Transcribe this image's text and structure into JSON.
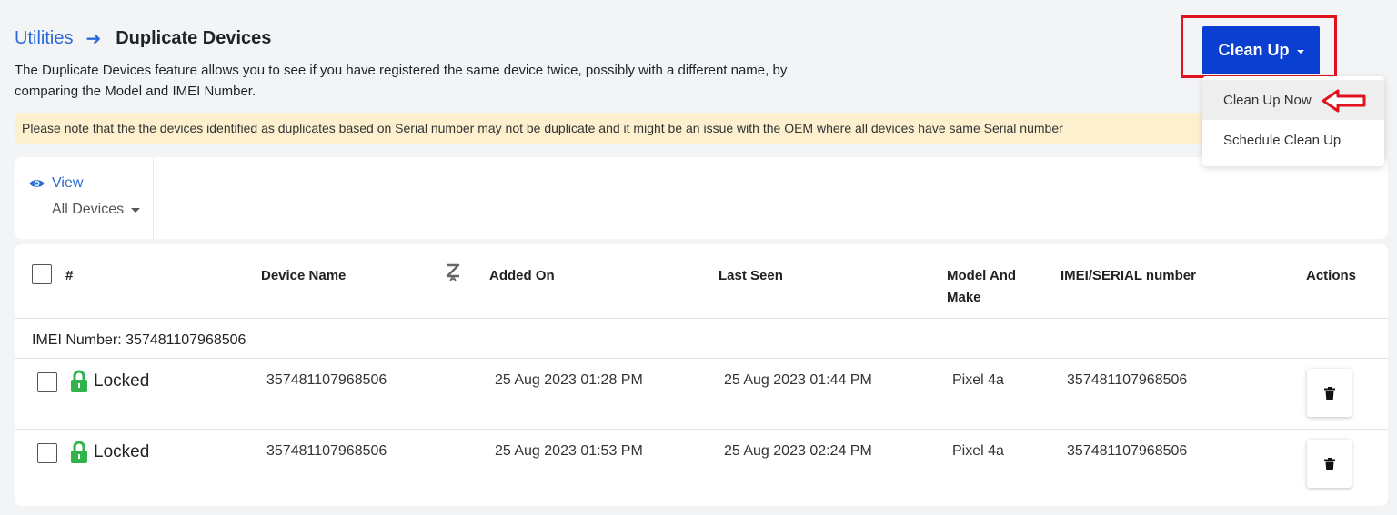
{
  "breadcrumb": {
    "parent": "Utilities",
    "current": "Duplicate Devices"
  },
  "description": "The Duplicate Devices feature allows you to see if you have registered the same device twice, possibly with a different name, by comparing the Model and IMEI Number.",
  "note": "Please note that the the devices identified as duplicates based on Serial number may not be duplicate and it might be an issue with the OEM where all devices have same Serial number",
  "cleanup": {
    "label": "Clean Up",
    "menu": [
      {
        "label": "Clean Up Now",
        "highlighted": true
      },
      {
        "label": "Schedule Clean Up",
        "highlighted": false
      }
    ]
  },
  "view": {
    "label": "View",
    "selected": "All Devices"
  },
  "table": {
    "columns": {
      "index": "#",
      "device_name": "Device Name",
      "added_on": "Added On",
      "last_seen": "Last Seen",
      "model_make": "Model And Make",
      "imei": "IMEI/SERIAL number",
      "actions": "Actions"
    },
    "group": {
      "label": "IMEI Number:",
      "value": "357481107968506"
    },
    "rows": [
      {
        "status": "Locked",
        "device_name": "357481107968506",
        "added_on": "25 Aug 2023 01:28 PM",
        "last_seen": "25 Aug 2023 01:44 PM",
        "model": "Pixel 4a",
        "imei": "357481107968506"
      },
      {
        "status": "Locked",
        "device_name": "357481107968506",
        "added_on": "25 Aug 2023 01:53 PM",
        "last_seen": "25 Aug 2023 02:24 PM",
        "model": "Pixel 4a",
        "imei": "357481107968506"
      }
    ]
  },
  "colors": {
    "accent": "#0b3fd1",
    "link": "#2a6ad8",
    "note_bg": "#fcf0cf",
    "lock": "#2fb34a",
    "highlight": "#e0141e"
  },
  "icons": {
    "view": "eye-icon",
    "sort": "sort-za-icon",
    "status": "lock-icon",
    "delete": "trash-icon"
  }
}
